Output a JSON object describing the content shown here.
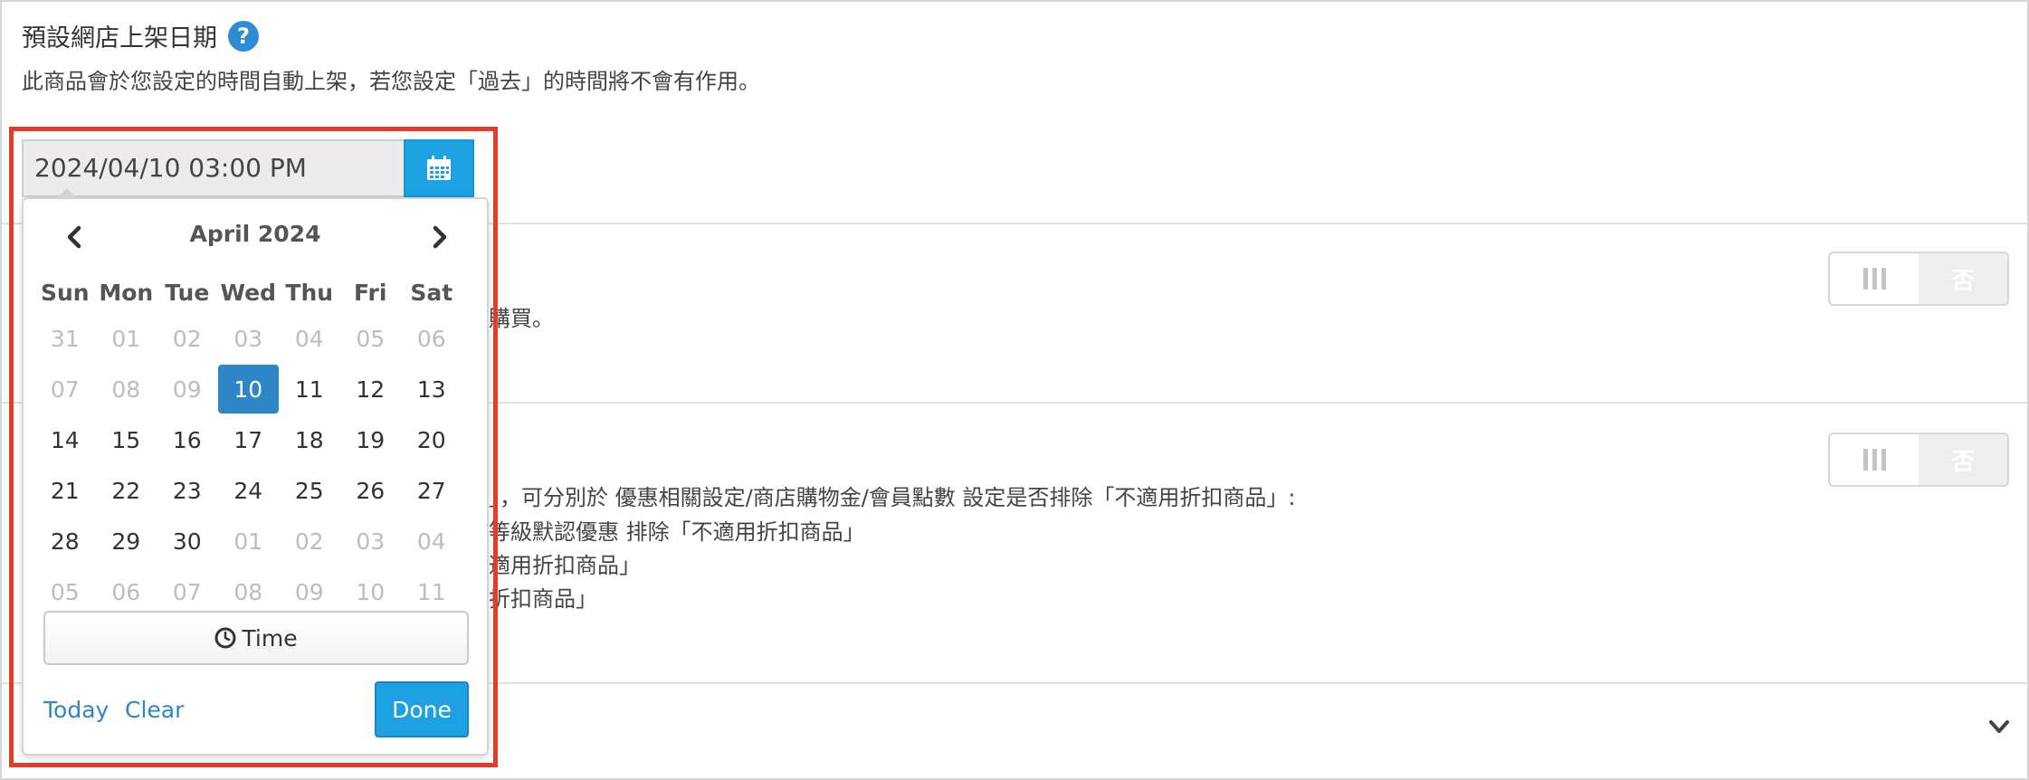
{
  "section1": {
    "title": "預設網店上架日期",
    "description": "此商品會於您設定的時間自動上架，若您設定「過去」的時間將不會有作用。"
  },
  "section2": {
    "desc_visible": "購買。",
    "toggle": {
      "on_label": "|||",
      "off_label": "否"
    }
  },
  "section3": {
    "lines": [
      "」，可分別於 優惠相關設定/商店購物金/會員點數 設定是否排除「不適用折扣商品」:",
      "等級默認優惠 排除「不適用折扣商品」",
      "適用折扣商品」",
      "折扣商品」"
    ],
    "toggle": {
      "on_label": "|||",
      "off_label": "否"
    }
  },
  "datetime_input": {
    "value": "2024/04/10 03:00 PM",
    "icon": "calendar-icon"
  },
  "datepicker": {
    "month_label": "April 2024",
    "prev_icon": "chevron-left-icon",
    "next_icon": "chevron-right-icon",
    "weekdays": [
      "Sun",
      "Mon",
      "Tue",
      "Wed",
      "Thu",
      "Fri",
      "Sat"
    ],
    "weeks": [
      [
        [
          "31",
          "muted"
        ],
        [
          "01",
          "muted"
        ],
        [
          "02",
          "muted"
        ],
        [
          "03",
          "muted"
        ],
        [
          "04",
          "muted"
        ],
        [
          "05",
          "muted"
        ],
        [
          "06",
          "muted"
        ]
      ],
      [
        [
          "07",
          "muted"
        ],
        [
          "08",
          "muted"
        ],
        [
          "09",
          "muted"
        ],
        [
          "10",
          "selected"
        ],
        [
          "11",
          ""
        ],
        [
          "12",
          ""
        ],
        [
          "13",
          ""
        ]
      ],
      [
        [
          "14",
          ""
        ],
        [
          "15",
          ""
        ],
        [
          "16",
          ""
        ],
        [
          "17",
          ""
        ],
        [
          "18",
          ""
        ],
        [
          "19",
          ""
        ],
        [
          "20",
          ""
        ]
      ],
      [
        [
          "21",
          ""
        ],
        [
          "22",
          ""
        ],
        [
          "23",
          ""
        ],
        [
          "24",
          ""
        ],
        [
          "25",
          ""
        ],
        [
          "26",
          ""
        ],
        [
          "27",
          ""
        ]
      ],
      [
        [
          "28",
          ""
        ],
        [
          "29",
          ""
        ],
        [
          "30",
          ""
        ],
        [
          "01",
          "muted"
        ],
        [
          "02",
          "muted"
        ],
        [
          "03",
          "muted"
        ],
        [
          "04",
          "muted"
        ]
      ],
      [
        [
          "05",
          "muted"
        ],
        [
          "06",
          "muted"
        ],
        [
          "07",
          "muted"
        ],
        [
          "08",
          "muted"
        ],
        [
          "09",
          "muted"
        ],
        [
          "10",
          "muted"
        ],
        [
          "11",
          "muted"
        ]
      ]
    ],
    "time_label": "Time",
    "today_label": "Today",
    "clear_label": "Clear",
    "done_label": "Done"
  },
  "colors": {
    "accent": "#1da1e2",
    "selected_day": "#2f86c6",
    "highlight_border": "#e53b2a",
    "help_icon": "#2f8bd3"
  }
}
